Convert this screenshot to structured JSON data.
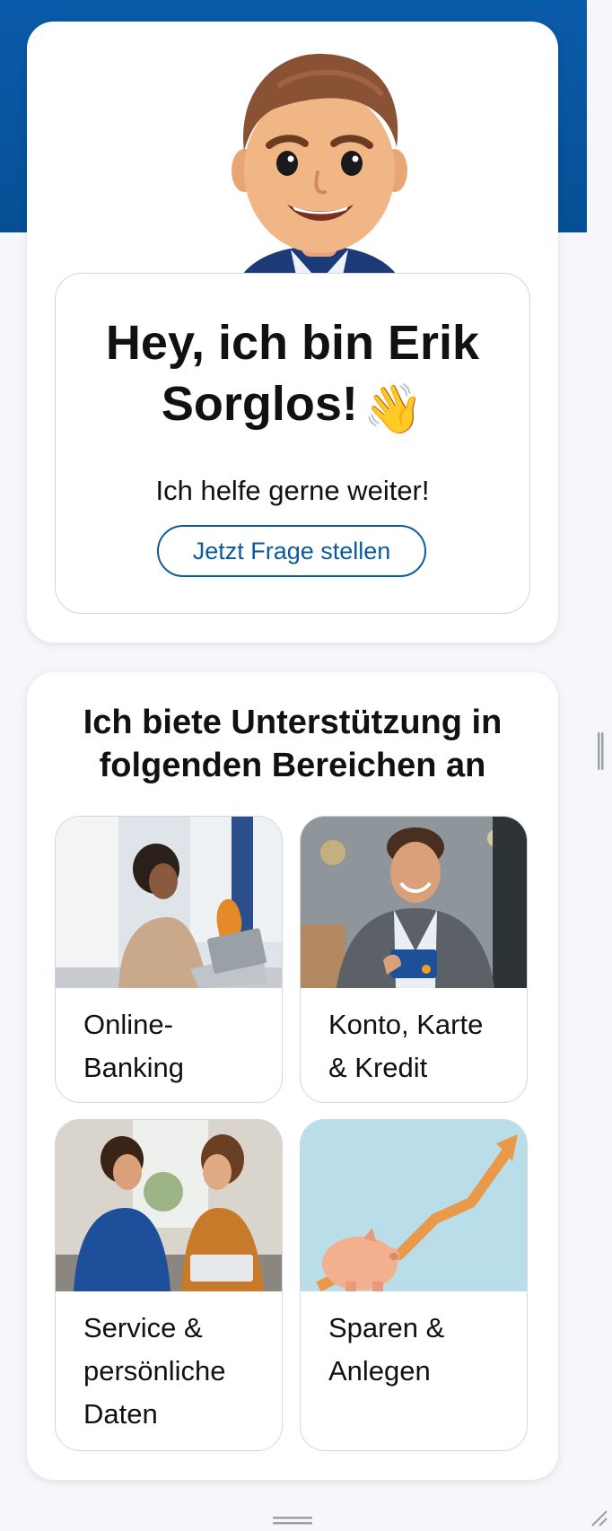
{
  "hero": {
    "headline_line1": "Hey, ich bin Erik",
    "headline_line2": "Sorglos!",
    "wave_emoji": "👋",
    "subtitle": "Ich helfe gerne weiter!",
    "button_label": "Jetzt Frage stellen"
  },
  "areas": {
    "title_line1": "Ich biete Unterstützung in",
    "title_line2": "folgenden Bereichen an",
    "items": [
      {
        "label_line1": "Online-",
        "label_line2": "Banking",
        "label_line3": ""
      },
      {
        "label_line1": "Konto, Karte",
        "label_line2": "& Kredit",
        "label_line3": ""
      },
      {
        "label_line1": "Service &",
        "label_line2": "persönliche",
        "label_line3": "Daten"
      },
      {
        "label_line1": "Sparen &",
        "label_line2": "Anlegen",
        "label_line3": ""
      }
    ]
  },
  "colors": {
    "brand_blue": "#0b5b9c",
    "header_blue": "#0a5ba9"
  },
  "icons": [
    "avatar-erik",
    "wave-hand-icon",
    "drag-handle-icon",
    "resize-corner-icon"
  ]
}
